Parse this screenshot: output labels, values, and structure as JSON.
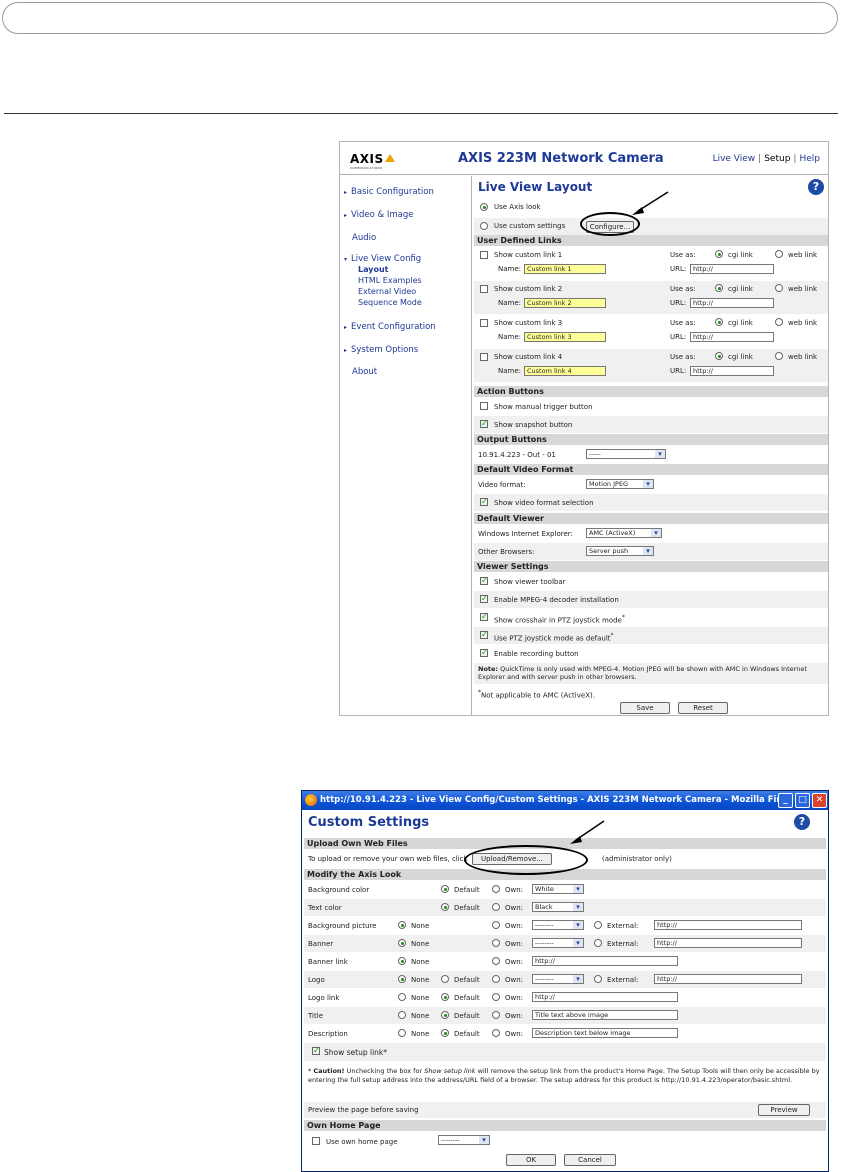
{
  "shot1": {
    "logo": {
      "text": "AXIS",
      "sub": "COMMUNICATIONS"
    },
    "product_title": "AXIS 223M Network Camera",
    "toplinks": {
      "live_view": "Live View",
      "sep1": "|",
      "setup": "Setup",
      "sep2": "|",
      "help": "Help"
    },
    "nav": {
      "items": [
        {
          "label": "Basic Configuration",
          "arrow": true
        },
        {
          "label": "Video & Image",
          "arrow": true
        },
        {
          "label": "Audio",
          "arrow": false
        },
        {
          "label": "Live View Config",
          "arrow": true
        },
        {
          "label": "Event Configuration",
          "arrow": true
        },
        {
          "label": "System Options",
          "arrow": true
        },
        {
          "label": "About",
          "arrow": false
        }
      ],
      "sub": [
        "Layout",
        "HTML Examples",
        "External Video",
        "Sequence Mode"
      ]
    },
    "page_title": "Live View Layout",
    "use_axis_look": "Use Axis look",
    "use_custom_settings": "Use custom settings",
    "configure_button": "Configure...",
    "sections": {
      "user_links": "User Defined Links",
      "action_buttons": "Action Buttons",
      "output_buttons": "Output Buttons",
      "default_video_format": "Default Video Format",
      "default_viewer": "Default Viewer",
      "viewer_settings": "Viewer Settings"
    },
    "custom_links": [
      {
        "show": "Show custom link 1",
        "name_label": "Name:",
        "name": "Custom link 1",
        "use_as": "Use as:",
        "cgi": "cgi link",
        "web": "web link",
        "url_label": "URL:",
        "url": "http://"
      },
      {
        "show": "Show custom link 2",
        "name_label": "Name:",
        "name": "Custom link 2",
        "use_as": "Use as:",
        "cgi": "cgi link",
        "web": "web link",
        "url_label": "URL:",
        "url": "http://"
      },
      {
        "show": "Show custom link 3",
        "name_label": "Name:",
        "name": "Custom link 3",
        "use_as": "Use as:",
        "cgi": "cgi link",
        "web": "web link",
        "url_label": "URL:",
        "url": "http://"
      },
      {
        "show": "Show custom link 4",
        "name_label": "Name:",
        "name": "Custom link 4",
        "use_as": "Use as:",
        "cgi": "cgi link",
        "web": "web link",
        "url_label": "URL:",
        "url": "http://"
      }
    ],
    "show_manual_trigger": "Show manual trigger button",
    "show_snapshot": "Show snapshot button",
    "output_label": "10.91.4.223 - Out - 01",
    "output_select": "-----",
    "video_format_label": "Video format:",
    "video_format_select": "Motion JPEG",
    "show_video_format_selection": "Show video format selection",
    "wie_label": "Windows Internet Explorer:",
    "wie_select": "AMC (ActiveX)",
    "other_browsers_label": "Other Browsers:",
    "other_browsers_select": "Server push",
    "viewer": {
      "toolbar": "Show viewer toolbar",
      "mpeg4": "Enable MPEG-4 decoder installation",
      "crosshair": "Show crosshair in PTZ joystick mode",
      "crosshair_sup": "*",
      "ptz_default": "Use PTZ joystick mode as default",
      "ptz_sup": "*",
      "recording": "Enable recording button"
    },
    "note_bold": "Note:",
    "note_text": "QuickTime is only used with MPEG-4. Motion JPEG will be shown with AMC in Windows Internet Explorer and with server push in other browsers.",
    "footnote_star": "*",
    "footnote": "Not applicable to AMC (ActiveX).",
    "save": "Save",
    "reset": "Reset"
  },
  "shot2": {
    "window_title": "http://10.91.4.223 - Live View Config/Custom Settings - AXIS 223M Network Camera - Mozilla Fir...",
    "win_min": "_",
    "win_max": "□",
    "win_close": "✕",
    "title": "Custom Settings",
    "sections": {
      "upload": "Upload Own Web Files",
      "modify": "Modify the Axis Look",
      "own_home": "Own Home Page"
    },
    "upload_text": "To upload or remove your own web files, click",
    "upload_button": "Upload/Remove...",
    "admin_only": "(administrator only)",
    "opts": {
      "none": "None",
      "default": "Default",
      "own": "Own:",
      "external": "External:"
    },
    "rows": [
      {
        "label": "Background color",
        "own_select": "White"
      },
      {
        "label": "Text color",
        "own_select": "Black"
      },
      {
        "label": "Background picture",
        "own_select": "--------",
        "external": "http://"
      },
      {
        "label": "Banner",
        "own_select": "--------",
        "external": "http://"
      },
      {
        "label": "Banner link",
        "own_input": "http://"
      },
      {
        "label": "Logo",
        "own_select": "--------",
        "external": "http://"
      },
      {
        "label": "Logo link",
        "own_input": "http://"
      },
      {
        "label": "Title",
        "own_input": "Title text above image"
      },
      {
        "label": "Description",
        "own_input": "Description text below image"
      }
    ],
    "show_setup_link": "Show setup link*",
    "caution_star": "*",
    "caution_bold": "Caution!",
    "caution_text1": "Unchecking the box for",
    "caution_italic": "Show setup link",
    "caution_text2": "will remove the setup link from the product's Home Page. The Setup Tools will then only be accessible by entering the full setup address into the address/URL field of a browser. The setup address for this product is http://10.91.4.223/operator/basic.shtml.",
    "preview_text": "Preview the page before saving",
    "preview_button": "Preview",
    "use_own_home": "Use own home page",
    "own_home_select": "--------",
    "ok": "OK",
    "cancel": "Cancel"
  },
  "colors": {
    "link": "#1e3a96",
    "section_bg": "#d7d7d7",
    "titlebar": "#0a52d6",
    "checked": "#1a8a1a",
    "yellow_input": "#ffff99"
  }
}
